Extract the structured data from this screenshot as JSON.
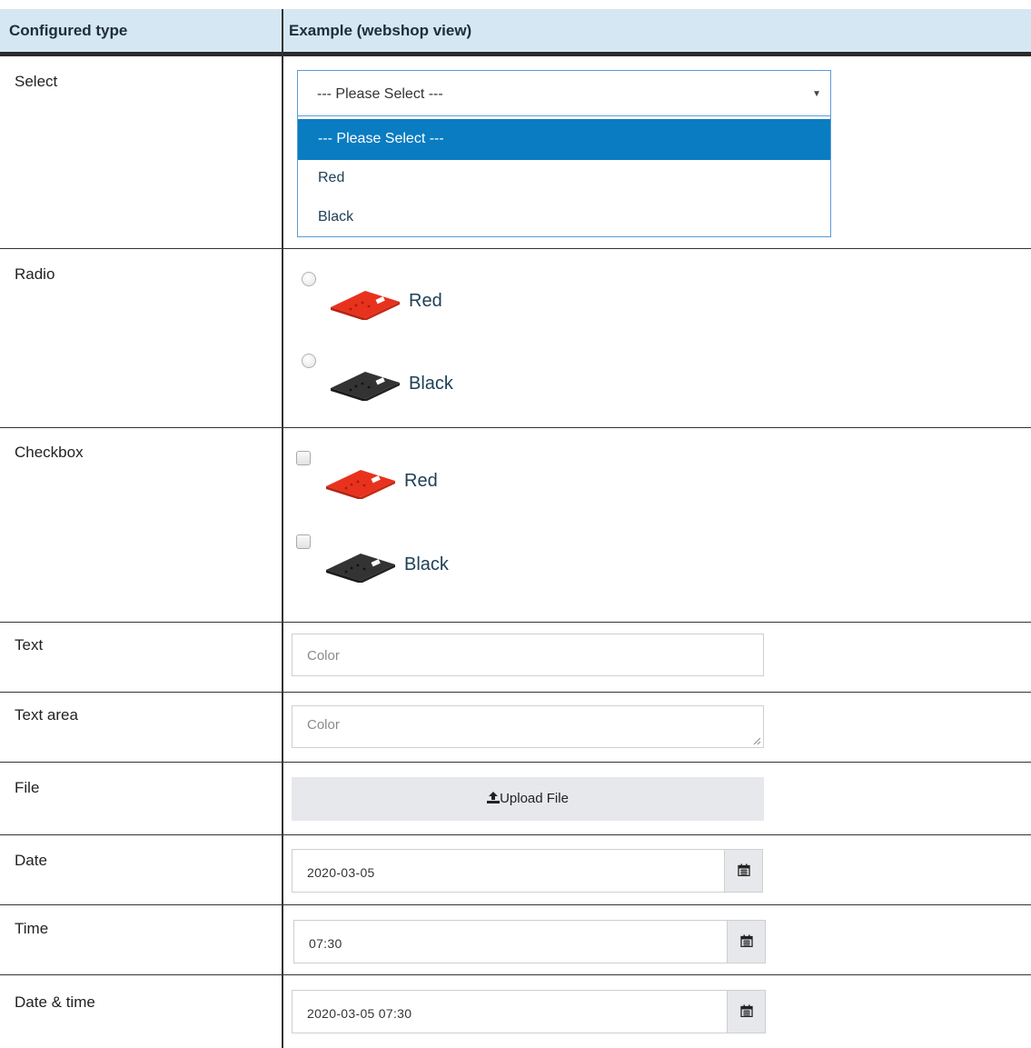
{
  "headers": {
    "configured_type": "Configured type",
    "example": "Example (webshop view)"
  },
  "rows": {
    "select": {
      "label": "Select",
      "selected_value": "--- Please Select ---",
      "options": [
        "--- Please Select ---",
        "Red",
        "Black"
      ]
    },
    "radio": {
      "label": "Radio",
      "options": [
        "Red",
        "Black"
      ]
    },
    "checkbox": {
      "label": "Checkbox",
      "options": [
        "Red",
        "Black"
      ]
    },
    "text": {
      "label": "Text",
      "placeholder": "Color"
    },
    "textarea": {
      "label": "Text area",
      "placeholder": "Color"
    },
    "file": {
      "label": "File",
      "button": "Upload File"
    },
    "date": {
      "label": "Date",
      "value": "2020-03-05"
    },
    "time": {
      "label": "Time",
      "value": "07:30"
    },
    "datetime": {
      "label": "Date & time",
      "value": "2020-03-05 07:30"
    }
  },
  "icons": {
    "upload": "upload-icon",
    "calendar": "calendar-icon",
    "caret": "caret-down-icon"
  },
  "colors": {
    "header_bg": "#d5e7f2",
    "highlight": "#0a7cc2",
    "red_part": "#e8321e",
    "black_part": "#2e2e2e"
  }
}
